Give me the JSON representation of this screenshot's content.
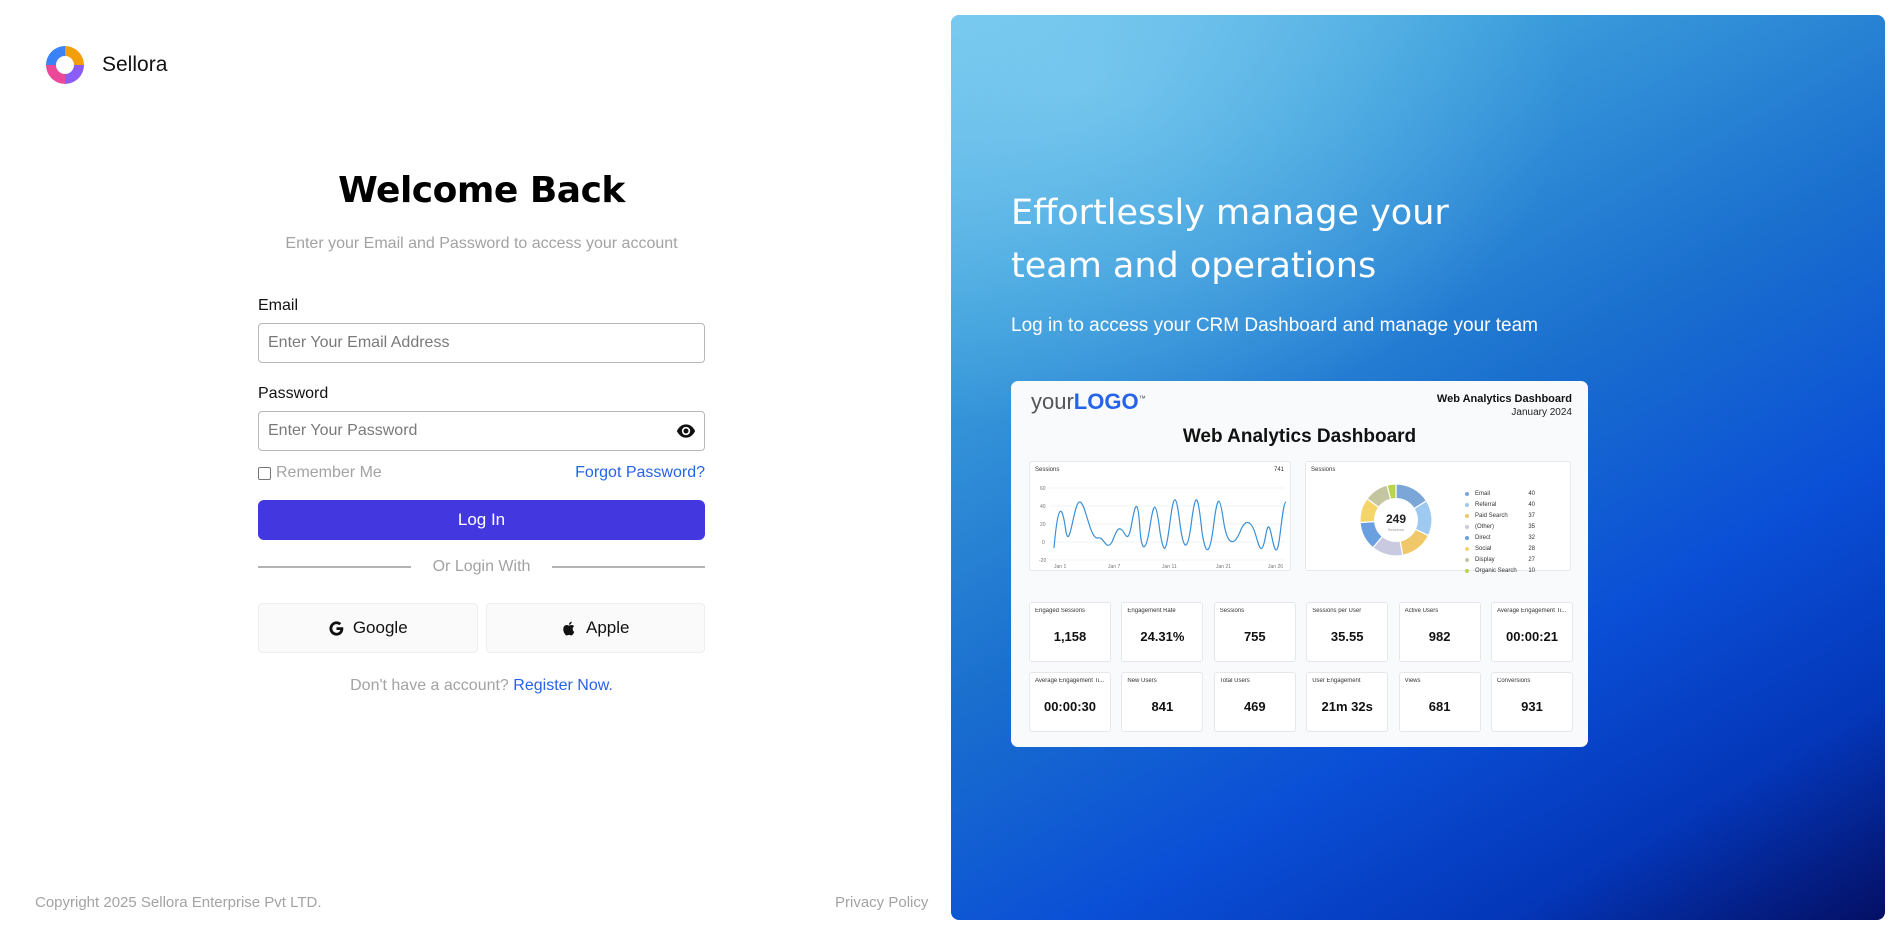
{
  "brand": {
    "name": "Sellora"
  },
  "form": {
    "title": "Welcome Back",
    "subtitle": "Enter your Email and Password to access your account",
    "email_label": "Email",
    "email_placeholder": "Enter Your Email Address",
    "email_value": "",
    "password_label": "Password",
    "password_placeholder": "Enter Your Password",
    "password_value": "",
    "remember_label": "Remember Me",
    "forgot_label": "Forgot Password?",
    "login_label": "Log In",
    "divider_label": "Or Login With",
    "google_label": "Google",
    "apple_label": "Apple",
    "register_prompt": "Don't have a account?",
    "register_link": "Register Now."
  },
  "footer": {
    "copyright": "Copyright 2025 Sellora Enterprise Pvt LTD.",
    "privacy": "Privacy Policy"
  },
  "promo": {
    "headline": "Effortlessly manage your team and operations",
    "subline": "Log in to access your CRM Dashboard and manage your team"
  },
  "preview": {
    "logo_prefix": "your",
    "logo_bold": "LOGO",
    "logo_tm": "™",
    "header_title": "Web Analytics Dashboard",
    "header_date": "January 2024",
    "main_title": "Web Analytics Dashboard",
    "sessions_chart_label": "Sessions",
    "sessions_chart_value": "741",
    "donut_label": "Sessions",
    "donut_center": "249",
    "donut_center_sub": "Sessions",
    "x_ticks": [
      "Jan 1",
      "Jan 7",
      "Jan 11",
      "Jan 21",
      "Jan 26"
    ],
    "y_ticks": [
      "60",
      "40",
      "20",
      "0",
      "-20"
    ],
    "legend": [
      {
        "name": "Email",
        "value": "40",
        "color": "#7aa7d8"
      },
      {
        "name": "Referral",
        "value": "40",
        "color": "#9ec9f0"
      },
      {
        "name": "Paid Search",
        "value": "37",
        "color": "#f0c869"
      },
      {
        "name": "(Other)",
        "value": "35",
        "color": "#c9c9e0"
      },
      {
        "name": "Direct",
        "value": "32",
        "color": "#6aa0e0"
      },
      {
        "name": "Social",
        "value": "28",
        "color": "#f5d468"
      },
      {
        "name": "Display",
        "value": "27",
        "color": "#c4c6a0"
      },
      {
        "name": "Organic Search",
        "value": "10",
        "color": "#b8d44a"
      }
    ],
    "metrics_row1": [
      {
        "label": "Engaged Sessions",
        "value": "1,158"
      },
      {
        "label": "Engagement Rate",
        "value": "24.31%"
      },
      {
        "label": "Sessions",
        "value": "755"
      },
      {
        "label": "Sessions per User",
        "value": "35.55"
      },
      {
        "label": "Active Users",
        "value": "982"
      },
      {
        "label": "Average Engagement Ti...",
        "value": "00:00:21"
      }
    ],
    "metrics_row2": [
      {
        "label": "Average Engagement Ti...",
        "value": "00:00:30"
      },
      {
        "label": "New Users",
        "value": "841"
      },
      {
        "label": "Total Users",
        "value": "469"
      },
      {
        "label": "User Engagement",
        "value": "21m 32s"
      },
      {
        "label": "Views",
        "value": "681"
      },
      {
        "label": "Conversions",
        "value": "931"
      }
    ]
  },
  "colors": {
    "primary": "#4338e0",
    "link": "#2563eb",
    "muted": "#a3a3a3"
  }
}
